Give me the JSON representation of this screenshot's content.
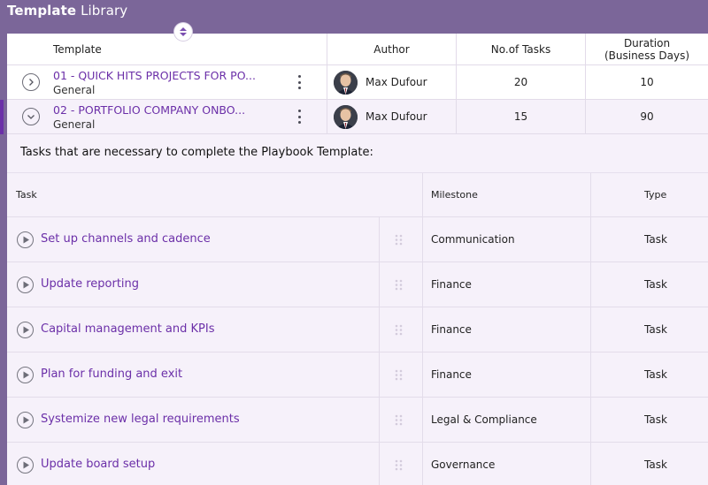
{
  "header": {
    "title_bold": "Template",
    "title_rest": "Library"
  },
  "columns": {
    "template": "Template",
    "author": "Author",
    "tasks": "No.of Tasks",
    "duration_line1": "Duration",
    "duration_line2": "(Business Days)"
  },
  "templates": [
    {
      "name": "01 - QUICK HITS PROJECTS FOR PO...",
      "category": "General",
      "author": "Max Dufour",
      "tasks": "20",
      "duration": "10",
      "expanded": false
    },
    {
      "name": "02 - PORTFOLIO COMPANY ONBO...",
      "category": "General",
      "author": "Max Dufour",
      "tasks": "15",
      "duration": "90",
      "expanded": true
    }
  ],
  "tasks_section": {
    "heading": "Tasks that are necessary to complete the Playbook Template:",
    "columns": {
      "task": "Task",
      "milestone": "Milestone",
      "type": "Type"
    },
    "rows": [
      {
        "name": "Set up channels and cadence",
        "milestone": "Communication",
        "type": "Task"
      },
      {
        "name": "Update reporting",
        "milestone": "Finance",
        "type": "Task"
      },
      {
        "name": "Capital management and KPIs",
        "milestone": "Finance",
        "type": "Task"
      },
      {
        "name": "Plan for funding and exit",
        "milestone": "Finance",
        "type": "Task"
      },
      {
        "name": "Systemize new legal requirements",
        "milestone": "Legal & Compliance",
        "type": "Task"
      },
      {
        "name": "Update board setup",
        "milestone": "Governance",
        "type": "Task"
      }
    ]
  },
  "icons": {
    "expand": "chevron-right-icon",
    "collapse": "chevron-down-icon",
    "play": "play-icon",
    "drag": "drag-handle-icon",
    "menu": "kebab-menu-icon",
    "sort": "sort-icon"
  },
  "colors": {
    "header_bg": "#7b6699",
    "accent": "#6b2fa8",
    "panel_bg": "#f6f1fa"
  }
}
